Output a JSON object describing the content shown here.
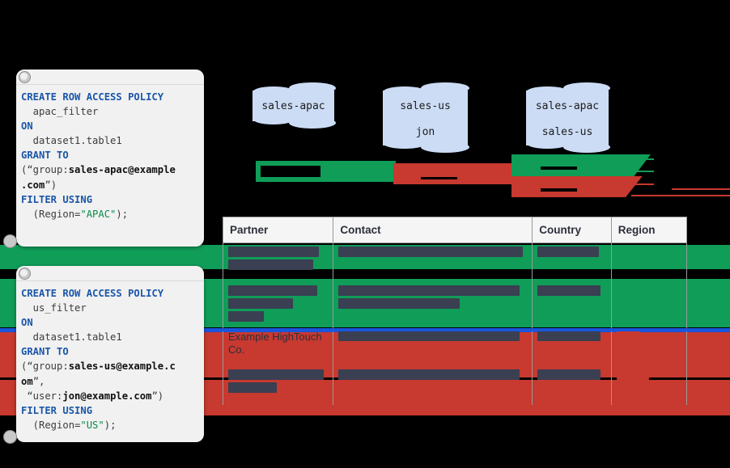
{
  "policies": [
    {
      "id": "apac-policy",
      "lines": [
        {
          "parts": [
            {
              "t": "CREATE ROW ACCESS POLICY",
              "s": "kw"
            }
          ]
        },
        {
          "parts": [
            {
              "t": "  apac_filter",
              "s": "pl"
            }
          ]
        },
        {
          "parts": [
            {
              "t": "ON",
              "s": "kw"
            }
          ]
        },
        {
          "parts": [
            {
              "t": "  dataset1.table1",
              "s": "pl"
            }
          ]
        },
        {
          "parts": [
            {
              "t": "GRANT TO",
              "s": "kw"
            }
          ]
        },
        {
          "parts": [
            {
              "t": "(“group:",
              "s": "pl"
            },
            {
              "t": "sales-apac@example",
              "s": "bld"
            }
          ]
        },
        {
          "parts": [
            {
              "t": ".com",
              "s": "bld"
            },
            {
              "t": "”)",
              "s": "pl"
            }
          ]
        },
        {
          "parts": [
            {
              "t": "FILTER USING",
              "s": "kw"
            }
          ]
        },
        {
          "parts": [
            {
              "t": "  (Region=",
              "s": "pl"
            },
            {
              "t": "\"APAC\"",
              "s": "str"
            },
            {
              "t": ");",
              "s": "pl"
            }
          ]
        }
      ]
    },
    {
      "id": "us-policy",
      "lines": [
        {
          "parts": [
            {
              "t": "CREATE ROW ACCESS POLICY",
              "s": "kw"
            }
          ]
        },
        {
          "parts": [
            {
              "t": "  us_filter",
              "s": "pl"
            }
          ]
        },
        {
          "parts": [
            {
              "t": "ON",
              "s": "kw"
            }
          ]
        },
        {
          "parts": [
            {
              "t": "  dataset1.table1",
              "s": "pl"
            }
          ]
        },
        {
          "parts": [
            {
              "t": "GRANT TO",
              "s": "kw"
            }
          ]
        },
        {
          "parts": [
            {
              "t": "(“group:",
              "s": "pl"
            },
            {
              "t": "sales-us@example.c",
              "s": "bld"
            }
          ]
        },
        {
          "parts": [
            {
              "t": "om",
              "s": "bld"
            },
            {
              "t": "”,",
              "s": "pl"
            }
          ]
        },
        {
          "parts": [
            {
              "t": " “user:",
              "s": "pl"
            },
            {
              "t": "jon@example.com",
              "s": "bld"
            },
            {
              "t": "”)",
              "s": "pl"
            }
          ]
        },
        {
          "parts": [
            {
              "t": "FILTER USING",
              "s": "kw"
            }
          ]
        },
        {
          "parts": [
            {
              "t": "  (Region=",
              "s": "pl"
            },
            {
              "t": "\"US\"",
              "s": "str"
            },
            {
              "t": ");",
              "s": "pl"
            }
          ]
        }
      ]
    }
  ],
  "flags": {
    "apac_left": "sales-apac",
    "us_top": "sales-us",
    "us_bottom": "jon",
    "right_top": "sales-apac",
    "right_bottom": "sales-us"
  },
  "table": {
    "headers": [
      "Partner",
      "Contact",
      "Country",
      "Region"
    ],
    "rows": [
      {
        "band": "green",
        "partner": "",
        "partner_redacted": true,
        "contact": "",
        "country": "",
        "region": ""
      },
      {
        "band": "green",
        "partner": "",
        "partner_redacted": true,
        "contact": "",
        "country": "",
        "region": ""
      },
      {
        "band": "red",
        "partner": "Example HighTouch Co.",
        "partner_redacted": false,
        "contact": "",
        "country": "",
        "region": ""
      },
      {
        "band": "red",
        "partner": "",
        "partner_redacted": true,
        "contact": "",
        "country": "",
        "region": ""
      }
    ]
  },
  "colors": {
    "green": "#0f9d58",
    "red": "#c8392f",
    "blue_divider": "#1a56db",
    "flag_fill": "#ccdcf5",
    "panel_bg": "#f1f1f1",
    "keyword": "#1a56a8",
    "string": "#0a8a4a",
    "background": "#000000"
  }
}
